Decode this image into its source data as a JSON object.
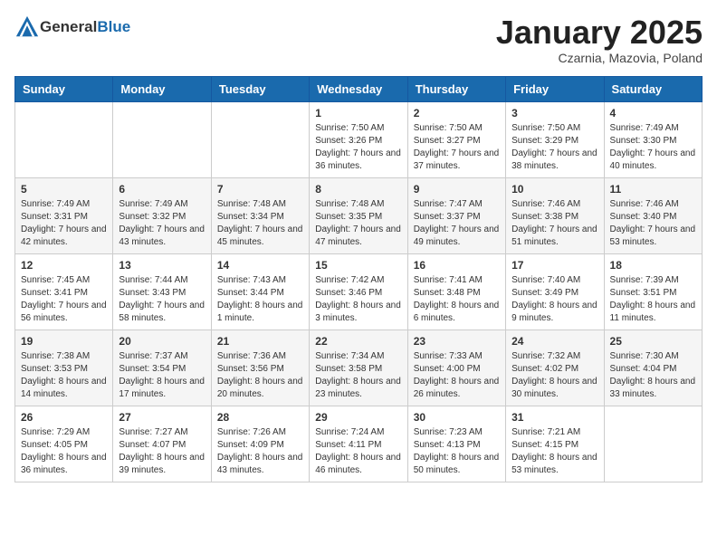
{
  "header": {
    "logo_general": "General",
    "logo_blue": "Blue",
    "month_title": "January 2025",
    "subtitle": "Czarnia, Mazovia, Poland"
  },
  "weekdays": [
    "Sunday",
    "Monday",
    "Tuesday",
    "Wednesday",
    "Thursday",
    "Friday",
    "Saturday"
  ],
  "weeks": [
    [
      {
        "day": "",
        "info": ""
      },
      {
        "day": "",
        "info": ""
      },
      {
        "day": "",
        "info": ""
      },
      {
        "day": "1",
        "info": "Sunrise: 7:50 AM\nSunset: 3:26 PM\nDaylight: 7 hours and 36 minutes."
      },
      {
        "day": "2",
        "info": "Sunrise: 7:50 AM\nSunset: 3:27 PM\nDaylight: 7 hours and 37 minutes."
      },
      {
        "day": "3",
        "info": "Sunrise: 7:50 AM\nSunset: 3:29 PM\nDaylight: 7 hours and 38 minutes."
      },
      {
        "day": "4",
        "info": "Sunrise: 7:49 AM\nSunset: 3:30 PM\nDaylight: 7 hours and 40 minutes."
      }
    ],
    [
      {
        "day": "5",
        "info": "Sunrise: 7:49 AM\nSunset: 3:31 PM\nDaylight: 7 hours and 42 minutes."
      },
      {
        "day": "6",
        "info": "Sunrise: 7:49 AM\nSunset: 3:32 PM\nDaylight: 7 hours and 43 minutes."
      },
      {
        "day": "7",
        "info": "Sunrise: 7:48 AM\nSunset: 3:34 PM\nDaylight: 7 hours and 45 minutes."
      },
      {
        "day": "8",
        "info": "Sunrise: 7:48 AM\nSunset: 3:35 PM\nDaylight: 7 hours and 47 minutes."
      },
      {
        "day": "9",
        "info": "Sunrise: 7:47 AM\nSunset: 3:37 PM\nDaylight: 7 hours and 49 minutes."
      },
      {
        "day": "10",
        "info": "Sunrise: 7:46 AM\nSunset: 3:38 PM\nDaylight: 7 hours and 51 minutes."
      },
      {
        "day": "11",
        "info": "Sunrise: 7:46 AM\nSunset: 3:40 PM\nDaylight: 7 hours and 53 minutes."
      }
    ],
    [
      {
        "day": "12",
        "info": "Sunrise: 7:45 AM\nSunset: 3:41 PM\nDaylight: 7 hours and 56 minutes."
      },
      {
        "day": "13",
        "info": "Sunrise: 7:44 AM\nSunset: 3:43 PM\nDaylight: 7 hours and 58 minutes."
      },
      {
        "day": "14",
        "info": "Sunrise: 7:43 AM\nSunset: 3:44 PM\nDaylight: 8 hours and 1 minute."
      },
      {
        "day": "15",
        "info": "Sunrise: 7:42 AM\nSunset: 3:46 PM\nDaylight: 8 hours and 3 minutes."
      },
      {
        "day": "16",
        "info": "Sunrise: 7:41 AM\nSunset: 3:48 PM\nDaylight: 8 hours and 6 minutes."
      },
      {
        "day": "17",
        "info": "Sunrise: 7:40 AM\nSunset: 3:49 PM\nDaylight: 8 hours and 9 minutes."
      },
      {
        "day": "18",
        "info": "Sunrise: 7:39 AM\nSunset: 3:51 PM\nDaylight: 8 hours and 11 minutes."
      }
    ],
    [
      {
        "day": "19",
        "info": "Sunrise: 7:38 AM\nSunset: 3:53 PM\nDaylight: 8 hours and 14 minutes."
      },
      {
        "day": "20",
        "info": "Sunrise: 7:37 AM\nSunset: 3:54 PM\nDaylight: 8 hours and 17 minutes."
      },
      {
        "day": "21",
        "info": "Sunrise: 7:36 AM\nSunset: 3:56 PM\nDaylight: 8 hours and 20 minutes."
      },
      {
        "day": "22",
        "info": "Sunrise: 7:34 AM\nSunset: 3:58 PM\nDaylight: 8 hours and 23 minutes."
      },
      {
        "day": "23",
        "info": "Sunrise: 7:33 AM\nSunset: 4:00 PM\nDaylight: 8 hours and 26 minutes."
      },
      {
        "day": "24",
        "info": "Sunrise: 7:32 AM\nSunset: 4:02 PM\nDaylight: 8 hours and 30 minutes."
      },
      {
        "day": "25",
        "info": "Sunrise: 7:30 AM\nSunset: 4:04 PM\nDaylight: 8 hours and 33 minutes."
      }
    ],
    [
      {
        "day": "26",
        "info": "Sunrise: 7:29 AM\nSunset: 4:05 PM\nDaylight: 8 hours and 36 minutes."
      },
      {
        "day": "27",
        "info": "Sunrise: 7:27 AM\nSunset: 4:07 PM\nDaylight: 8 hours and 39 minutes."
      },
      {
        "day": "28",
        "info": "Sunrise: 7:26 AM\nSunset: 4:09 PM\nDaylight: 8 hours and 43 minutes."
      },
      {
        "day": "29",
        "info": "Sunrise: 7:24 AM\nSunset: 4:11 PM\nDaylight: 8 hours and 46 minutes."
      },
      {
        "day": "30",
        "info": "Sunrise: 7:23 AM\nSunset: 4:13 PM\nDaylight: 8 hours and 50 minutes."
      },
      {
        "day": "31",
        "info": "Sunrise: 7:21 AM\nSunset: 4:15 PM\nDaylight: 8 hours and 53 minutes."
      },
      {
        "day": "",
        "info": ""
      }
    ]
  ]
}
